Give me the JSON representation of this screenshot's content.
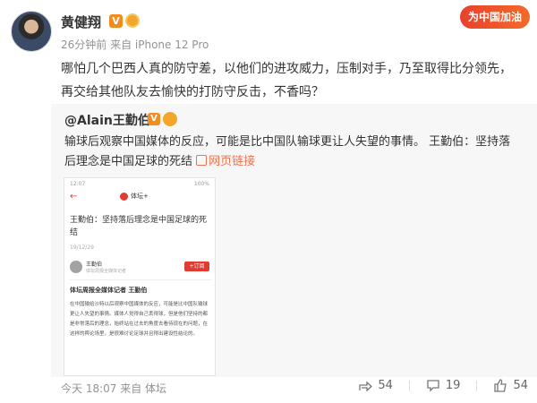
{
  "post": {
    "author": "黄健翔",
    "v_badge": "V",
    "meta": "26分钟前 来自 iPhone 12 Pro",
    "banner": "为中国加油",
    "text": "哪怕几个巴西人真的防守差，以他们的进攻威力，压制对手，乃至取得比分领先，再交给其他队友去愉快的打防守反击，不香吗？"
  },
  "repost": {
    "user": "@Alain王勤伯",
    "v_badge": "V",
    "text": "输球后观察中国媒体的反应，可能是比中国队输球更让人失望的事情。 王勤伯：坚持落后理念是中国足球的死结",
    "link_label": "网页链接",
    "screenshot": {
      "status_left": "12:07",
      "status_right": "100%",
      "back": "←",
      "brand": "体坛+",
      "title": "王勤伯：坚持落后理念是中国足球的死结",
      "date": "19/12/29",
      "author_name": "王勤伯",
      "author_role": "体坛周报全媒体记者",
      "subscribe": "+订阅",
      "heading": "体坛周报全媒体记者 王勤伯",
      "body": "在中国输给沙特以后观察中国媒体的反应，可能是比中国队输球更让人失望的事情。媒体人觉得自己丢得球，但是他们坚持的都是非常落后的理念，始终站在过去的角度去看待现在的问题，在这样的舆论场里，是很难讨论足球并且得出建设性结论的。"
    },
    "footer": "今天 18:07 来自 体坛"
  },
  "actions": {
    "share_count": "54",
    "comment_count": "19",
    "like_count": "54"
  },
  "colors": {
    "link": "#eb7350",
    "meta": "#939393",
    "accent": "#e03c31"
  }
}
